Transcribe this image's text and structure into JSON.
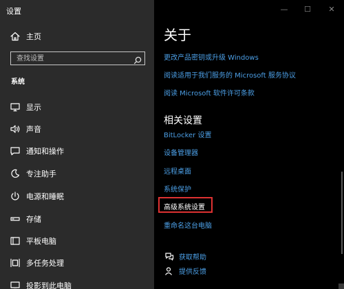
{
  "window": {
    "title": "设置",
    "minimize_glyph": "—",
    "maximize_glyph": "☐",
    "close_glyph": "✕"
  },
  "sidebar": {
    "home_label": "主页",
    "search_placeholder": "查找设置",
    "section_title": "系统",
    "items": [
      {
        "label": "显示",
        "icon": "display-icon"
      },
      {
        "label": "声音",
        "icon": "sound-icon"
      },
      {
        "label": "通知和操作",
        "icon": "notification-icon"
      },
      {
        "label": "专注助手",
        "icon": "focus-assist-icon"
      },
      {
        "label": "电源和睡眠",
        "icon": "power-icon"
      },
      {
        "label": "存储",
        "icon": "storage-icon"
      },
      {
        "label": "平板电脑",
        "icon": "tablet-icon"
      },
      {
        "label": "多任务处理",
        "icon": "multitasking-icon"
      },
      {
        "label": "投影到此电脑",
        "icon": "projecting-icon"
      }
    ]
  },
  "main": {
    "heading": "关于",
    "top_links": [
      "更改产品密钥或升级 Windows",
      "阅读适用于我们服务的 Microsoft 服务协议",
      "阅读 Microsoft 软件许可条款"
    ],
    "related_heading": "相关设置",
    "related_links": [
      "BitLocker 设置",
      "设备管理器",
      "远程桌面",
      "系统保护",
      "高级系统设置",
      "重命名这台电脑"
    ],
    "help_links": [
      {
        "label": "获取帮助",
        "icon": "get-help-icon"
      },
      {
        "label": "提供反馈",
        "icon": "feedback-icon"
      }
    ]
  },
  "colors": {
    "background": "#000000",
    "sidebar_background": "#2b2b2b",
    "link": "#4c9fe6",
    "highlight_border": "#e03232",
    "text": "#ffffff"
  }
}
